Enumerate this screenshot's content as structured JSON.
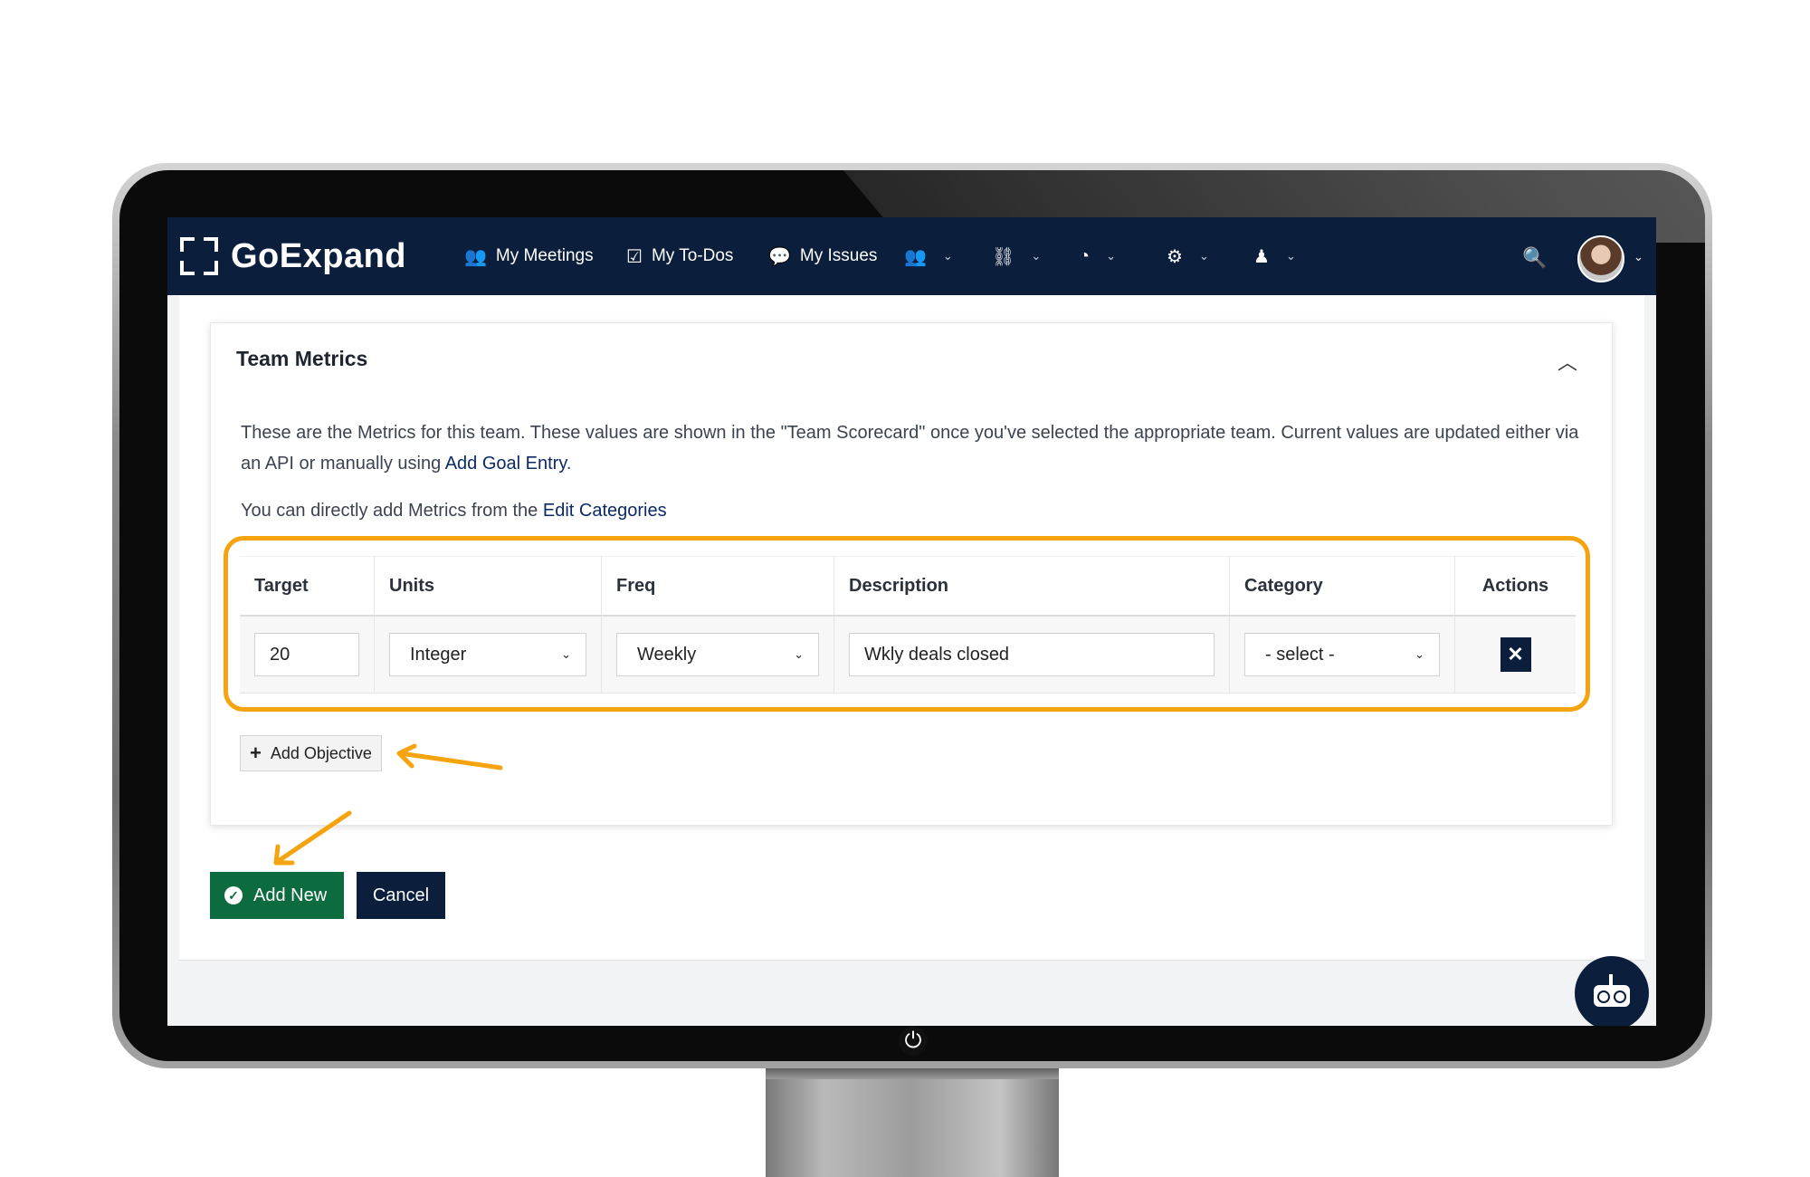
{
  "app": {
    "logo_text": "GoExpand"
  },
  "nav": {
    "items": [
      {
        "label": "My Meetings",
        "icon": "meetings-icon"
      },
      {
        "label": "My To-Dos",
        "icon": "checkbox-icon"
      },
      {
        "label": "My Issues",
        "icon": "chat-bubbles-icon"
      }
    ],
    "dropdowns": [
      "users-icon",
      "org-chart-icon",
      "dashboard-icon",
      "gear-icon",
      "mentor-icon"
    ]
  },
  "panel": {
    "title": "Team Metrics",
    "description_prefix": "These are the Metrics for this team. These values are shown in the \"Team Scorecard\" once you've selected the appropriate team. Current values are updated either via an API or manually using ",
    "description_link": "Add Goal Entry",
    "description_suffix": ".",
    "edit_prefix": "You can directly add Metrics from the ",
    "edit_link": "Edit Categories"
  },
  "table": {
    "headers": [
      "Target",
      "Units",
      "Freq",
      "Description",
      "Category",
      "Actions"
    ],
    "row": {
      "target": "20",
      "units": "Integer",
      "freq": "Weekly",
      "description": "Wkly deals closed",
      "category": "- select -",
      "action_icon": "close-icon"
    }
  },
  "buttons": {
    "add_objective": "Add Objective",
    "add_new": "Add New",
    "cancel": "Cancel"
  },
  "colors": {
    "navbar": "#0b1f3d",
    "highlight": "#f5a30f",
    "add_new": "#0d6b40",
    "link": "#0b2a66"
  }
}
